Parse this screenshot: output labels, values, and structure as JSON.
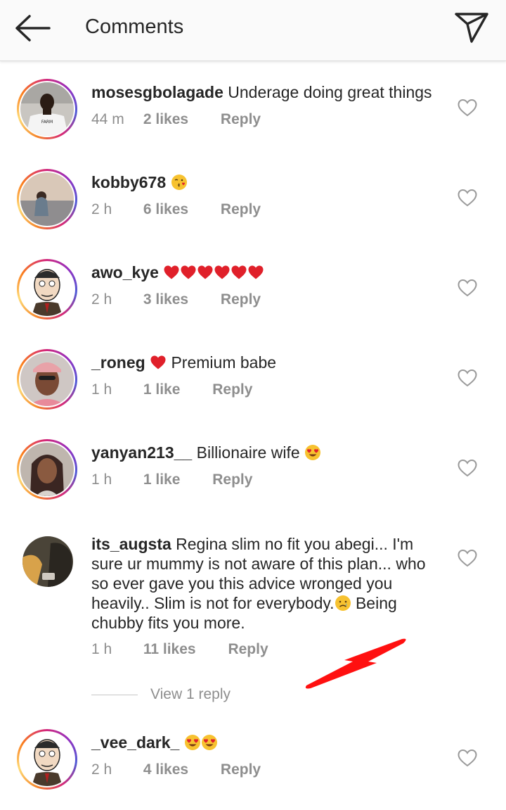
{
  "header": {
    "title": "Comments",
    "back_icon": "arrow-left-icon",
    "send_icon": "paper-plane-icon"
  },
  "comments": [
    {
      "username": "mosesgbolagade",
      "text": "Underage doing great things",
      "time": "44 m",
      "likes": "2 likes",
      "reply": "Reply"
    },
    {
      "username": "kobby678",
      "text": "",
      "time": "2 h",
      "likes": "6 likes",
      "reply": "Reply"
    },
    {
      "username": "awo_kye",
      "text": "",
      "time": "2 h",
      "likes": "3 likes",
      "reply": "Reply"
    },
    {
      "username": "_roneg",
      "text": "Premium babe",
      "time": "1 h",
      "likes": "1 like",
      "reply": "Reply"
    },
    {
      "username": "yanyan213__",
      "text": "Billionaire wife",
      "time": "1 h",
      "likes": "1 like",
      "reply": "Reply"
    },
    {
      "username": "its_augsta",
      "text": "Regina slim no fit you abegi... I'm sure ur mummy is not aware of this plan... who so ever gave you this advice wronged you heavily.. Slim is not for everybody.",
      "text_2": "Being chubby fits you more.",
      "time": "1 h",
      "likes": "11 likes",
      "reply": "Reply"
    },
    {
      "username": "_vee_dark_",
      "text": "",
      "time": "2 h",
      "likes": "4 likes",
      "reply": "Reply"
    }
  ],
  "view_replies": {
    "label": "View 1 reply"
  },
  "colors": {
    "heart_red": "#e0202a",
    "meta_gray": "#8e8e8e",
    "text": "#262626",
    "annotation_red": "#ff1010"
  }
}
